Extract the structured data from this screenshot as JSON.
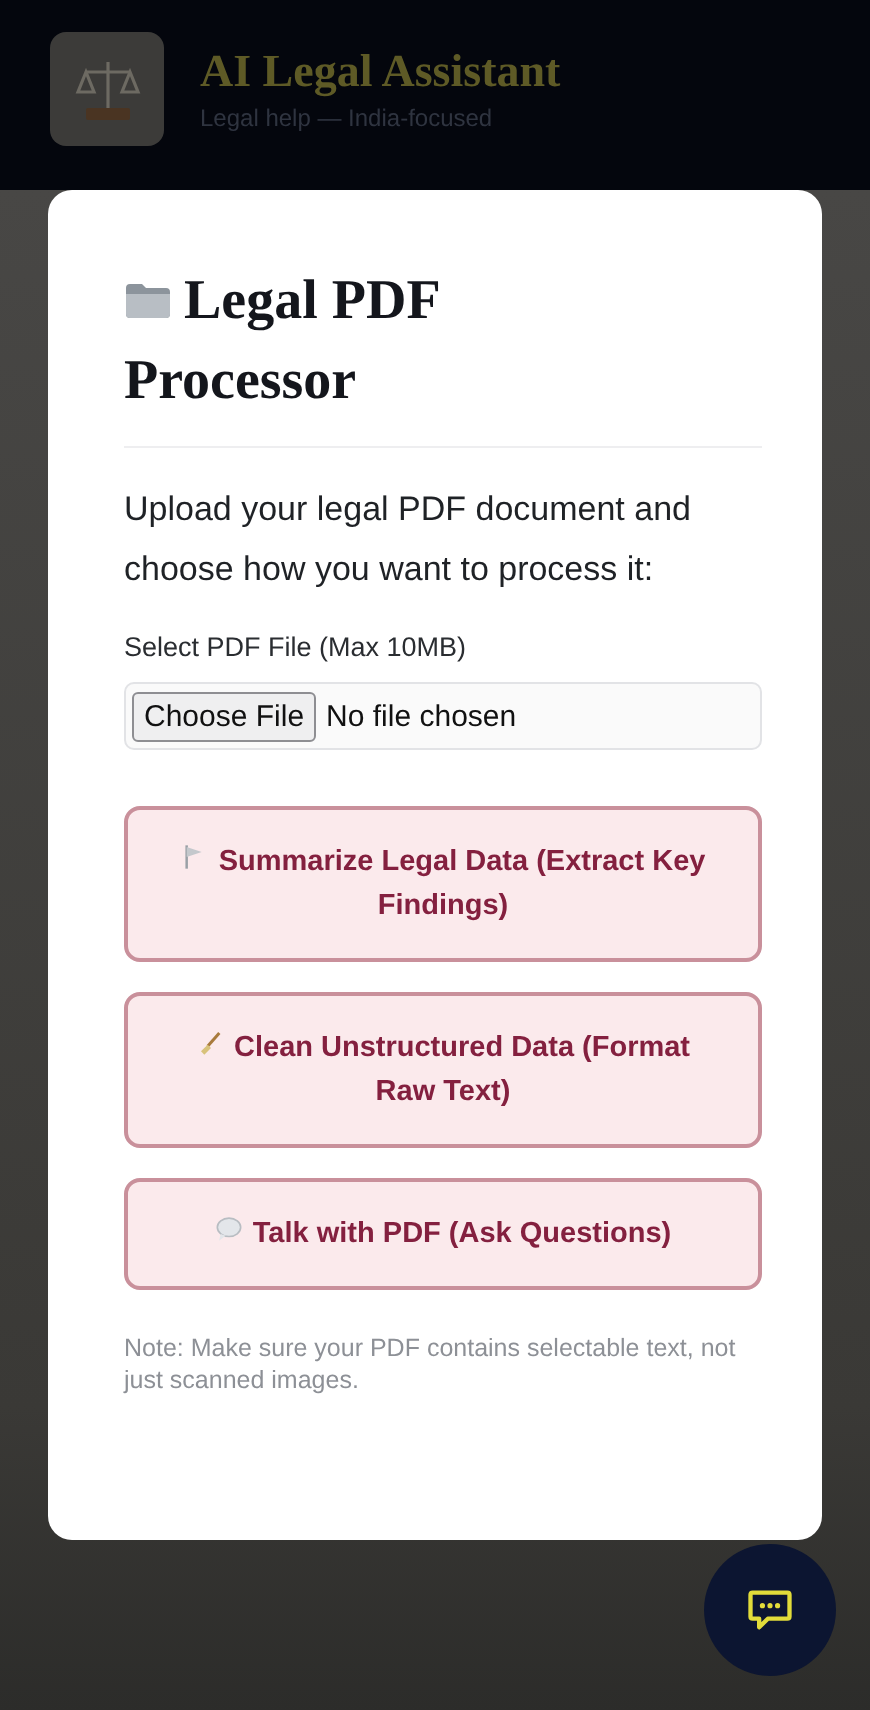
{
  "header": {
    "title": "AI Legal Assistant",
    "subtitle": "Legal help — India-focused"
  },
  "modal": {
    "title": "Legal PDF Processor",
    "intro": "Upload your legal PDF document and choose how you want to process it:",
    "file_label": "Select PDF File (Max 10MB)",
    "file_input": {
      "button_label": "Choose File",
      "status": "No file chosen"
    },
    "actions": [
      {
        "kind": "summarize",
        "label": "Summarize Legal Data (Extract Key Findings)"
      },
      {
        "kind": "clean",
        "label": "Clean Unstructured Data (Format Raw Text)"
      },
      {
        "kind": "chat",
        "label": "Talk with PDF (Ask Questions)"
      }
    ],
    "note": "Note: Make sure your PDF contains selectable text, not just scanned images."
  }
}
